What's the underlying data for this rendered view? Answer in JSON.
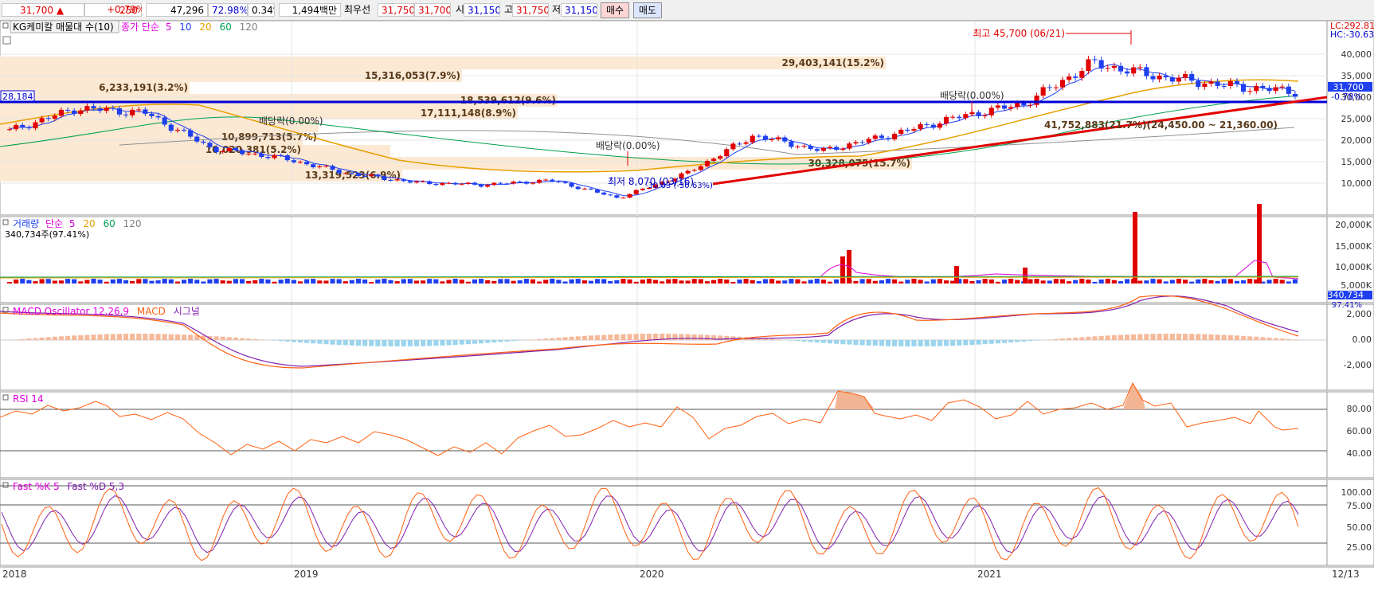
{
  "quote_bar": {
    "price": "31,700",
    "change_arrow": "▲",
    "change": "250",
    "change_pct": "+0.79%",
    "volume": "47,296",
    "ratio": "72.98%",
    "turnover": "0.34%",
    "amount": "1,494백만",
    "best_label": "최우선",
    "best_ask": "31,750",
    "best_bid": "31,700",
    "open_label": "시",
    "open": "31,150",
    "high_label": "고",
    "high": "31,750",
    "low_label": "저",
    "low": "31,150",
    "buy_label": "매수",
    "sell_label": "매도"
  },
  "price_panel": {
    "title": "KG케미칼 매물대 수(10)",
    "ma_prefix": "종가 단순",
    "ma_labels": [
      "5",
      "10",
      "20",
      "60",
      "120"
    ],
    "ma_colors": [
      "#e000e0",
      "#1f3ff0",
      "#e8a000",
      "#00a050",
      "#808080"
    ],
    "lc_label": "LC:292.81",
    "hc_label": "HC:-30.63",
    "last_price_tag": "31,700",
    "last_change_tag": "-0.78%",
    "hline_value_label": "28,184",
    "y_ticks": [
      "40,000",
      "35,000",
      "30,000",
      "25,000",
      "20,000",
      "15,000",
      "10,000"
    ],
    "annotations": {
      "high": "최고 45,700 (06/21)",
      "low": "최저 8,070 (03/16)",
      "low_pct": "-30.63 (-30.63%)",
      "div1": "배당락(0.00%)",
      "div2": "배당락(0.00%)",
      "div3": "배당락(0.00%)",
      "range": "41,752,883(21.7%)(24,450.00 ~ 21,360.00)"
    },
    "volume_profile": [
      {
        "label": "29,403,141(15.2%)"
      },
      {
        "label": "15,316,053(7.9%)"
      },
      {
        "label": "6,233,191(3.2%)"
      },
      {
        "label": "18,539,612(9.6%)"
      },
      {
        "label": "17,111,148(8.9%)"
      },
      {
        "label": "10,899,713(5.7%)"
      },
      {
        "label": "10,020,381(5.2%)"
      },
      {
        "label": "13,319,523(6.9%)"
      },
      {
        "label": "30,328,075(15.7%)"
      }
    ]
  },
  "volume_panel": {
    "title": "거래량",
    "ma_prefix": "단순",
    "ma_labels": [
      "5",
      "20",
      "60",
      "120"
    ],
    "ma_colors": [
      "#e000e0",
      "#e8a000",
      "#00a050",
      "#808080"
    ],
    "sub_label": "340,734주(97.41%)",
    "y_ticks": [
      "20,000K",
      "15,000K",
      "10,000K",
      "5,000K"
    ],
    "last_tag": "340,734",
    "last_pct_tag": "97.41%"
  },
  "macd_panel": {
    "title1": "MACD Oscillator 12,26,9",
    "title2": "MACD",
    "title3": "시그널",
    "y_ticks": [
      "2,000",
      "0.00",
      "-2,000"
    ]
  },
  "rsi_panel": {
    "title": "RSI 14",
    "y_ticks": [
      "80.00",
      "60.00",
      "40.00"
    ]
  },
  "stoch_panel": {
    "title1": "Fast %K 5",
    "title2": "Fast %D 5,3",
    "y_ticks": [
      "100.00",
      "75.00",
      "50.00",
      "25.00"
    ]
  },
  "x_axis": {
    "labels": [
      "2018",
      "2019",
      "2020",
      "2021",
      "12/13"
    ]
  },
  "chart_data": {
    "type": "candlestick",
    "x": [
      "2018-01",
      "2018-04",
      "2018-07",
      "2018-10",
      "2019-01",
      "2019-04",
      "2019-07",
      "2019-10",
      "2020-01",
      "2020-03",
      "2020-06",
      "2020-08",
      "2020-10",
      "2021-01",
      "2021-03",
      "2021-05",
      "2021-06",
      "2021-08",
      "2021-10",
      "2021-12"
    ],
    "close": [
      23000,
      28000,
      27000,
      19000,
      17000,
      13500,
      11500,
      11000,
      12000,
      8070,
      13500,
      22000,
      18500,
      22000,
      26000,
      29000,
      38000,
      35000,
      33000,
      31700
    ],
    "ylim": [
      5000,
      46000
    ],
    "high_marker": {
      "value": 45700,
      "date": "06/21"
    },
    "low_marker": {
      "value": 8070,
      "date": "03/16"
    },
    "horizontal_line": 28184,
    "grid": true
  }
}
